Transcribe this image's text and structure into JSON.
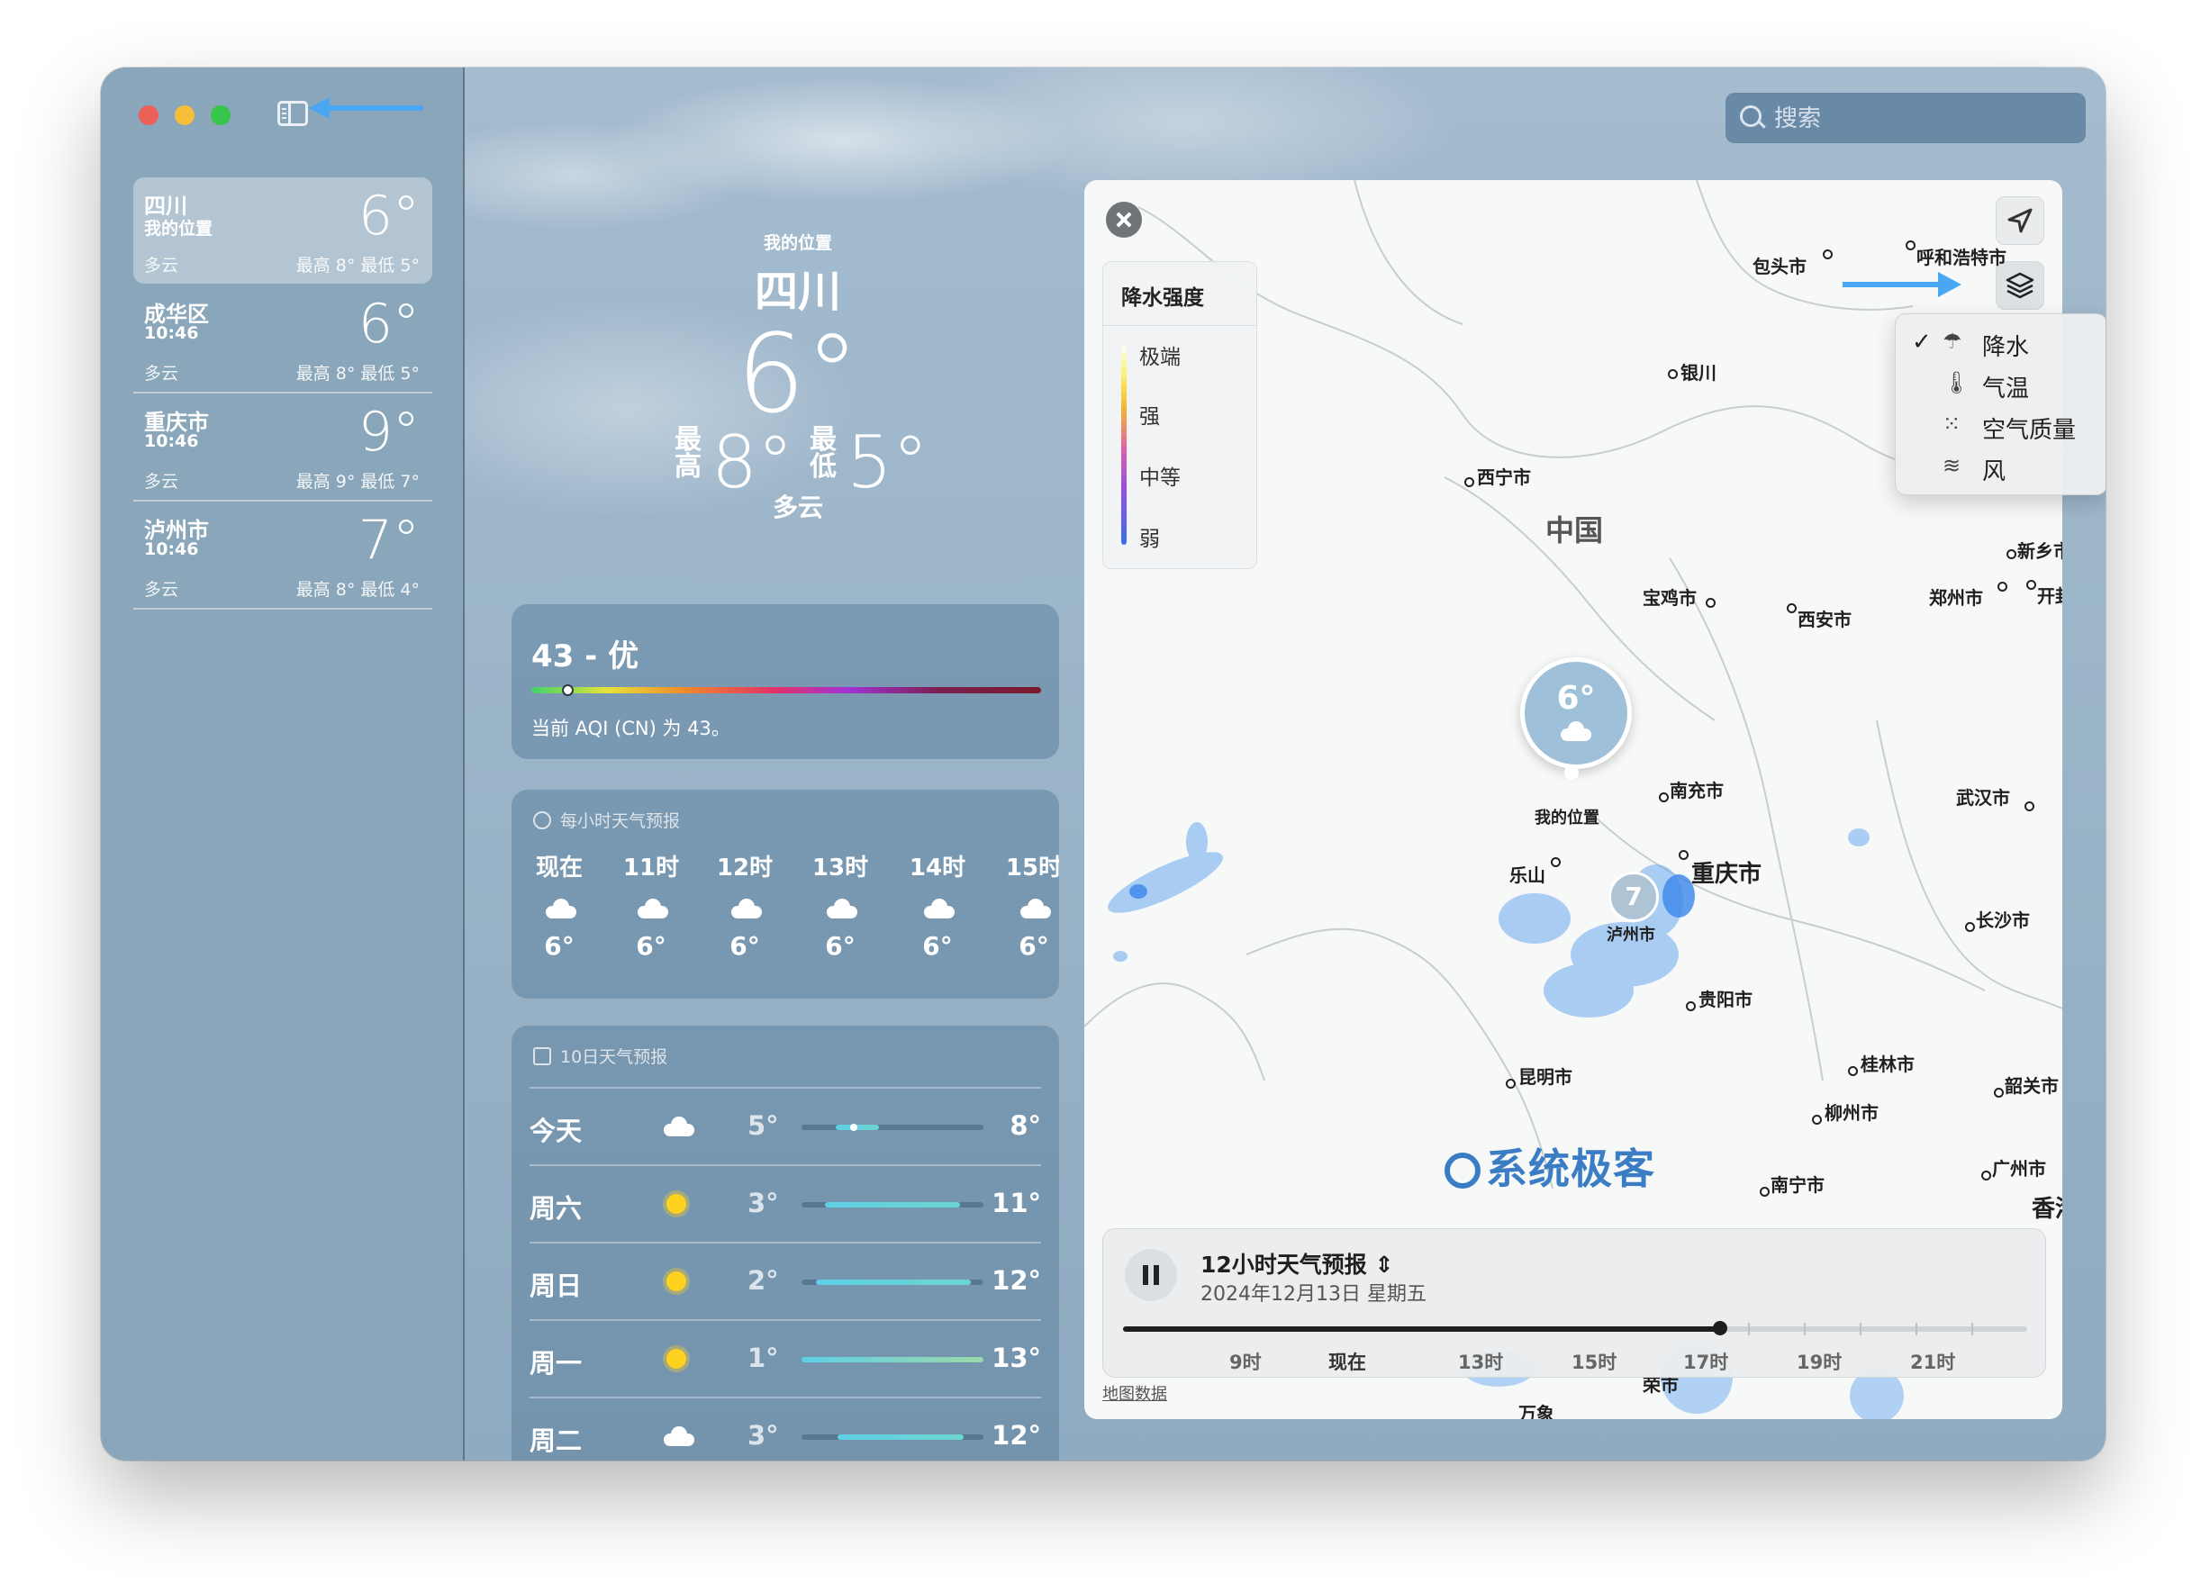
{
  "sidebar": {
    "locations": [
      {
        "name": "四川",
        "sub": "我的位置",
        "temp": "6°",
        "condition": "多云",
        "high_low": "最高 8°  最低 5°"
      },
      {
        "name": "成华区",
        "sub": "10:46",
        "temp": "6°",
        "condition": "多云",
        "high_low": "最高 8°  最低 5°"
      },
      {
        "name": "重庆市",
        "sub": "10:46",
        "temp": "9°",
        "condition": "多云",
        "high_low": "最高 9°  最低 7°"
      },
      {
        "name": "泸州市",
        "sub": "10:46",
        "temp": "7°",
        "condition": "多云",
        "high_low": "最高 8°  最低 4°"
      }
    ]
  },
  "search": {
    "placeholder": "搜索"
  },
  "hero": {
    "my_location": "我的位置",
    "city": "四川",
    "temp": "6°",
    "high_label": "最高",
    "high": "8°",
    "low_label": "最低",
    "low": "5°",
    "condition": "多云"
  },
  "aqi": {
    "value": "43 - 优",
    "description": "当前 AQI (CN) 为 43。",
    "level_fraction": 0.06
  },
  "hourly": {
    "title": "每小时天气预报",
    "hours": [
      {
        "time": "现在",
        "icon": "cloud-icon",
        "temp": "6°"
      },
      {
        "time": "11时",
        "icon": "cloud-icon",
        "temp": "6°"
      },
      {
        "time": "12时",
        "icon": "cloud-icon",
        "temp": "6°"
      },
      {
        "time": "13时",
        "icon": "cloud-icon",
        "temp": "6°"
      },
      {
        "time": "14时",
        "icon": "cloud-icon",
        "temp": "6°"
      },
      {
        "time": "15时",
        "icon": "cloud-icon",
        "temp": "6°"
      }
    ]
  },
  "tenday": {
    "title": "10日天气预报",
    "days": [
      {
        "day": "今天",
        "icon": "cloud-icon",
        "low": "5°",
        "high": "8°"
      },
      {
        "day": "周六",
        "icon": "sun-icon",
        "low": "3°",
        "high": "11°"
      },
      {
        "day": "周日",
        "icon": "sun-icon",
        "low": "2°",
        "high": "12°"
      },
      {
        "day": "周一",
        "icon": "sun-icon",
        "low": "1°",
        "high": "13°"
      },
      {
        "day": "周二",
        "icon": "cloud-icon",
        "low": "3°",
        "high": "12°"
      }
    ]
  },
  "map": {
    "legend_title": "降水强度",
    "legend_levels": [
      "极端",
      "强",
      "中等",
      "弱"
    ],
    "country": "中国",
    "pin_temp": "6°",
    "pin_label": "我的位置",
    "cluster_count": "7",
    "cities": [
      "包头市",
      "呼和浩特市",
      "银川",
      "西宁市",
      "新乡市",
      "郑州市",
      "开封",
      "宝鸡市",
      "西安市",
      "南充市",
      "武汉市",
      "乐山",
      "重庆市",
      "泸州市",
      "长沙市",
      "贵阳市",
      "昆明市",
      "桂林市",
      "韶关市",
      "柳州市",
      "广州市",
      "南宁市",
      "香港",
      "荣市",
      "万象"
    ],
    "credit": "地图数据",
    "watermark": "系统极客"
  },
  "layers_menu": {
    "items": [
      {
        "label": "降水",
        "icon": "umbrella-icon",
        "checked": true
      },
      {
        "label": "气温",
        "icon": "thermometer-icon",
        "checked": false
      },
      {
        "label": "空气质量",
        "icon": "air-quality-icon",
        "checked": false
      },
      {
        "label": "风",
        "icon": "wind-icon",
        "checked": false
      }
    ]
  },
  "timeline": {
    "title": "12小时天气预报",
    "date": "2024年12月13日 星期五",
    "labels": [
      "9时",
      "现在",
      "13时",
      "15时",
      "17时",
      "19时",
      "21时"
    ],
    "progress_fraction": 0.66
  },
  "colors": {
    "annotation_arrow": "#4aa8f2",
    "accent": "#3b7dc4"
  }
}
